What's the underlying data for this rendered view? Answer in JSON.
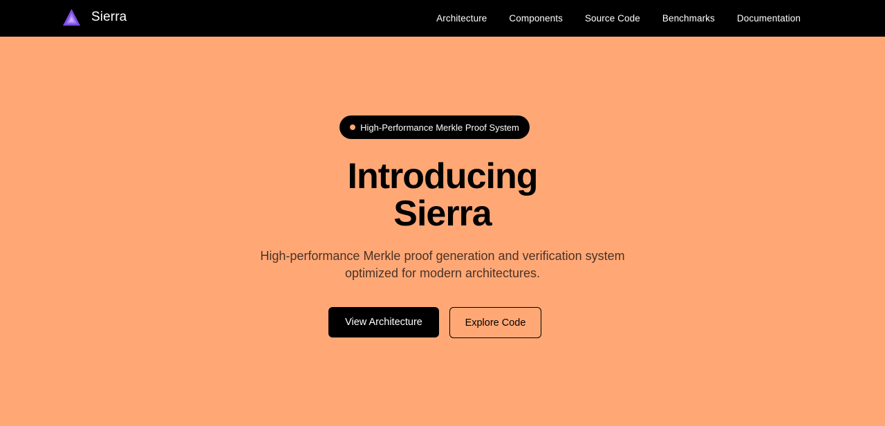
{
  "brand": {
    "name": "Sierra",
    "logo_icon": "triangle-logo-icon"
  },
  "nav": {
    "items": [
      {
        "label": "Architecture"
      },
      {
        "label": "Components"
      },
      {
        "label": "Source Code"
      },
      {
        "label": "Benchmarks"
      },
      {
        "label": "Documentation"
      }
    ]
  },
  "hero": {
    "badge_text": "High-Performance Merkle Proof System",
    "title_line1": "Introducing",
    "title_line2": "Sierra",
    "subtitle_line1": "High-performance Merkle proof generation and verification system",
    "subtitle_line2": "optimized for modern architectures.",
    "primary_button": "View Architecture",
    "secondary_button": "Explore Code"
  },
  "colors": {
    "background": "#FFA876",
    "nav_background": "#000000",
    "logo_purple": "#8B5CF6",
    "text": "#000000"
  }
}
